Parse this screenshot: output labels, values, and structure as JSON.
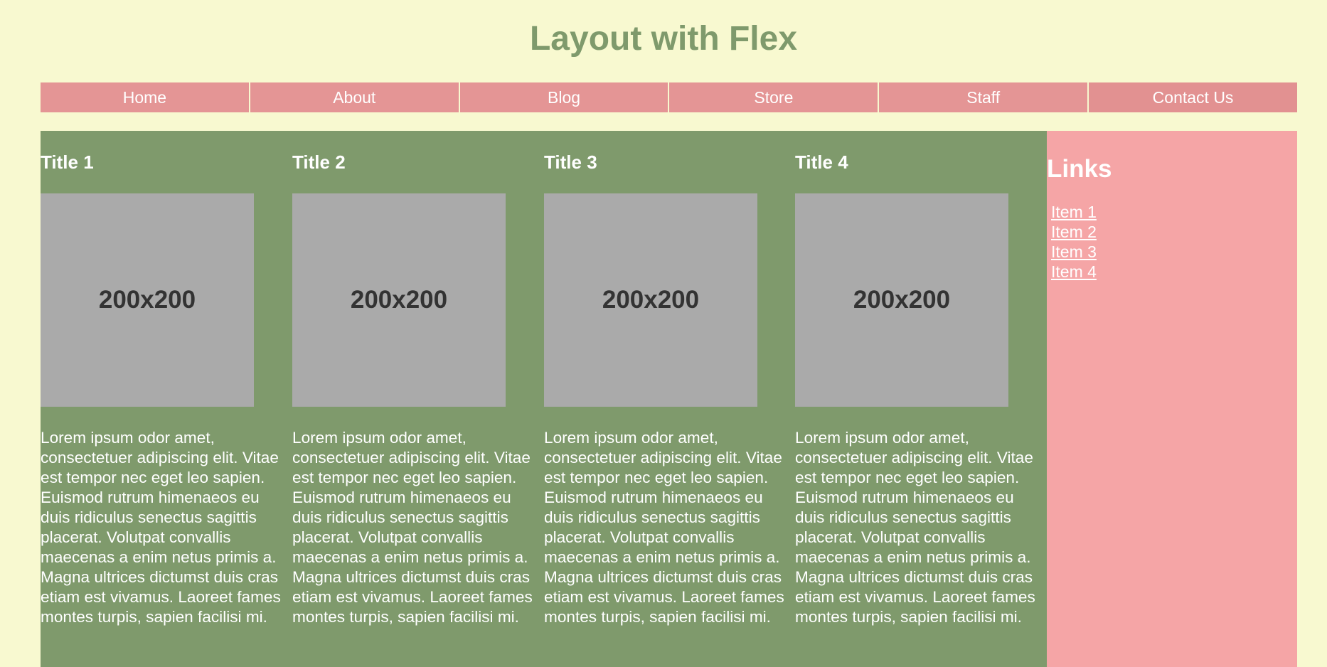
{
  "header": {
    "title": "Layout with Flex"
  },
  "nav": {
    "items": [
      {
        "label": "Home"
      },
      {
        "label": "About"
      },
      {
        "label": "Blog"
      },
      {
        "label": "Store"
      },
      {
        "label": "Staff"
      },
      {
        "label": "Contact Us"
      }
    ]
  },
  "cards": [
    {
      "title": "Title 1",
      "image_label": "200x200",
      "text": "Lorem ipsum odor amet, consectetuer adipiscing elit. Vitae est tempor nec eget leo sapien. Euismod rutrum himenaeos eu duis ridiculus senectus sagittis placerat. Volutpat convallis maecenas a enim netus primis a. Magna ultrices dictumst duis cras etiam est vivamus. Laoreet fames montes turpis, sapien facilisi mi."
    },
    {
      "title": "Title 2",
      "image_label": "200x200",
      "text": "Lorem ipsum odor amet, consectetuer adipiscing elit. Vitae est tempor nec eget leo sapien. Euismod rutrum himenaeos eu duis ridiculus senectus sagittis placerat. Volutpat convallis maecenas a enim netus primis a. Magna ultrices dictumst duis cras etiam est vivamus. Laoreet fames montes turpis, sapien facilisi mi."
    },
    {
      "title": "Title 3",
      "image_label": "200x200",
      "text": "Lorem ipsum odor amet, consectetuer adipiscing elit. Vitae est tempor nec eget leo sapien. Euismod rutrum himenaeos eu duis ridiculus senectus sagittis placerat. Volutpat convallis maecenas a enim netus primis a. Magna ultrices dictumst duis cras etiam est vivamus. Laoreet fames montes turpis, sapien facilisi mi."
    },
    {
      "title": "Title 4",
      "image_label": "200x200",
      "text": "Lorem ipsum odor amet, consectetuer adipiscing elit. Vitae est tempor nec eget leo sapien. Euismod rutrum himenaeos eu duis ridiculus senectus sagittis placerat. Volutpat convallis maecenas a enim netus primis a. Magna ultrices dictumst duis cras etiam est vivamus. Laoreet fames montes turpis, sapien facilisi mi."
    }
  ],
  "sidebar": {
    "title": "Links",
    "links": [
      {
        "label": "Item 1"
      },
      {
        "label": "Item 2"
      },
      {
        "label": "Item 3"
      },
      {
        "label": "Item 4"
      }
    ]
  },
  "colors": {
    "page_background": "#f8f9d0",
    "title_green": "#7f9a6c",
    "nav_pink": "#e49595",
    "main_green": "#7f9a6c",
    "sidebar_pink": "#f5a5a6",
    "placeholder_gray": "#aaaaaa"
  }
}
